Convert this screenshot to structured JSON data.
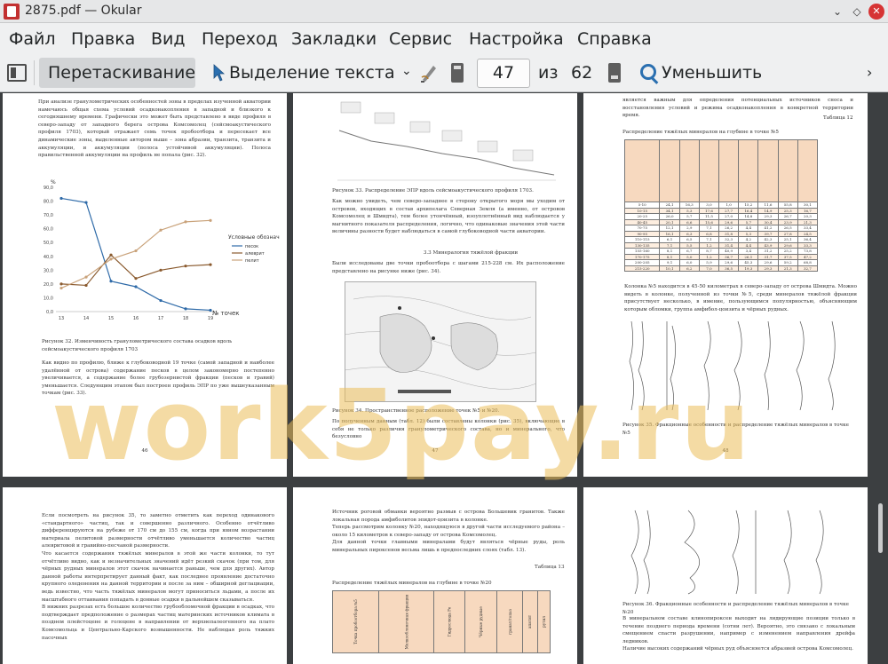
{
  "window": {
    "title": "2875.pdf  — Okular",
    "buttons": {
      "minimize": "⌄",
      "maximize": "◇",
      "close": "✕"
    }
  },
  "menubar": {
    "items": [
      "Файл",
      "Правка",
      "Вид",
      "Переход",
      "Закладки",
      "Сервис",
      "Настройка",
      "Справка"
    ]
  },
  "toolbar": {
    "drag_label": "Перетаскивание",
    "select_label": "Выделение текста",
    "chevron": "⌄",
    "page_current": "47",
    "page_of": "из",
    "page_total": "62",
    "zoom_label": "Уменьшить",
    "more": "›"
  },
  "watermark": "work5pay.ru",
  "pages": {
    "p46": {
      "intro": "При анализе гранулометрических особенностей зоны в пределах изученной акватории намечаюсь общая схема условий осадконакопления в западной и близкого к сегодняшнему времени. Графически это может быть представлено в виде профиля в северо-западу от западного берега острова Комсомолец (сейсмоакустического профиля 1703), который отражает семь точек пробоотбора и пересекает все динамические зоны, выделенные автором выше – зона абразии, транзита, транзита и аккумуляции, и аккумуляции (полоса устойчивой аккумуляции). Полоса правильственной аккумуляции на профиль не попала (рис. 32).",
      "legend_title": "Условные обозначения:",
      "caption": "Рисунок 32. Изменчивость гранулометрического состава осадков вдоль сейсмоакустического профиля 1703",
      "body": "Как видно по профилю, ближе к глубоководной 19 точке (самой западной и наиболее удалённой от острова) содержание песков в целом закономерно постепенно увеличивается, а содержание более грубозернистой фракции (песков и гравий) уменьшается. Следующим этапом был построен профиль ЭПР по уже вышеуказанным точкам (рис. 33).",
      "page_number": "46"
    },
    "p47": {
      "caption33": "Рисунок 33. Распределение ЭПР вдоль сейсмоакустического профиля 1703.",
      "body1": "Как можно увидеть, чем северо-западнее в сторону открытого моря мы уходим от островов, входящих в состав архипелага Северная Земля (а именно, от островов Комсомолец и Шмидта), тем более утончённый, изоуплотнённый вид наблюдается у магнитного показателя распределения, логично, что одинаковые значения этой части величины разности будет наблюдаться в самой глубоководной части акватории.",
      "heading": "3.3 Минералогия тяжёлой фракции",
      "body2": "Были исследованы две точки пробоотбора с шагами 215-228 см. Их расположение представлено на рисунке ниже (рис. 34).",
      "caption34": "Рисунок 34.  Пространственное расположение точек №5 и №20.",
      "body3": "По полученным данным (табл. 12) были составлены колонки (рис. 35), включающие в себя не только различия гранулометрического состава, но и минерального, что безусловно",
      "page_number": "47"
    },
    "p48": {
      "intro": "является важным для определения потенциальных источников сноса и восстановления условий и режима осадконакопления в конкретной территории время.",
      "table_label": "Таблица 12",
      "table_title": "Распределение тяжёлых минералов на глубине в точке №5",
      "body": "Колонка №5 находится в 45-50 километрах в северо-западу от острова Шмидта. Можно видеть в колонке, полученной из точки №5, среди минералов тяжёлой фракции присутствует несколько, в имение, пользующимся популярностью, объясняющим которым обломки, группа амфибол-цоизита и чёрных рудных.",
      "caption": "Рисунок 35. Фракционные особенности и распределение тяжёлых минералов в точке №5",
      "page_number": "48"
    },
    "p49": {
      "body": "Если посмотреть на рисунок 35, то заметно отметить как переход одинакового «стандартного» частиц, так и совершенно различного. Особенно отчётливо дифференцируются на рубеже от 170 см до 155 см, когда при явном возрастании материала пелитовой размерности отчётливо уменьшается количество частиц алевритовой и гравийно-песчаной размерности.\nЧто касается содержания тяжёлых минералов в этой же части колонки, то тут отчётливо видно, как и незначительных значений идёт резкий скачок (при том, для чёрных рудных минералов этот скачок начинается раньше, чем для других). Автор данной работы интерпретирует данный факт, как последнее проявление достаточно крупного оледенения на данной территории и после за ним – обширной деглациации, ведь известно, что часть тяжёлых минералов могут приноситься льдами, а после их масштабного оттаивания попадать в донные осадки в дальнейшем сказываться.\nВ нижних разрезах есть большое количество грубообломочной фракции в осадках, что подтверждает предположение о размерах частиц материнских источников климата в позднем плейстоцене и голоцене в направлении от верхнепалеогенного на плато Комсомольца и Центрально-Карского возвышенности. Не наблюдая роль тяжких пасочных"
    },
    "p50": {
      "body": "Источник роговой обманки вероятно размыв с острова Большевик гранитов. Также локальная порода амфиболитов эпидот-цоизита в колонке.\nТеперь рассмотрим колонку №20, находящуюся в другой части исследуемого района – около 15 километров к северо-западу от острова Комсомолец.\nДля данной точки главными минералами будут являться чёрные руды, роль минеральных пироксенов весьма лишь в предпоследних слоях (табл. 13).",
      "table_label": "Таблица 13",
      "table_title": "Распределение тяжёлых минералов на глубине в точке №20",
      "table_headers": [
        "Точка пробоотбора №5",
        "Мелкообломочная фракция",
        "Гидрослюда Fe",
        "Чёрные рудные",
        "гранат/топаз",
        "апатит",
        "рутил"
      ]
    },
    "p51": {
      "caption": "Рисунок 36. Фракционные особенности и распределение тяжёлых минералов в точке №20",
      "body": "В минеральном составе клинопироксен выходит на лидирующие позиции только в течение позднего периода времени (сотни лет). Вероятно, это связано с локальным смещением спасти разрушении, например с изменением направления дрейфа ледников.\nНаличие высоких содержаний чёрных руд объясняется абразией острова Комсомолец."
    }
  },
  "chart_data": {
    "type": "line",
    "title": "",
    "xlabel": "№ точек",
    "ylabel": "%",
    "x": [
      "13",
      "14",
      "15",
      "16",
      "17",
      "18",
      "19"
    ],
    "ylim": [
      0,
      90
    ],
    "yticks": [
      "0,0",
      "10,0",
      "20,0",
      "30,0",
      "40,0",
      "50,0",
      "60,0",
      "70,0",
      "80,0",
      "90,0"
    ],
    "series": [
      {
        "name": "песок",
        "values": [
          82,
          79,
          22,
          18,
          8,
          2,
          1
        ],
        "color": "#2e6aa8"
      },
      {
        "name": "алеврит",
        "values": [
          20,
          19,
          41,
          24,
          30,
          33,
          34
        ],
        "color": "#8a5a2e"
      },
      {
        "name": "пелит",
        "values": [
          17,
          25,
          38,
          44,
          59,
          65,
          66
        ],
        "color": "#c9a27a"
      }
    ],
    "legend": "right"
  }
}
